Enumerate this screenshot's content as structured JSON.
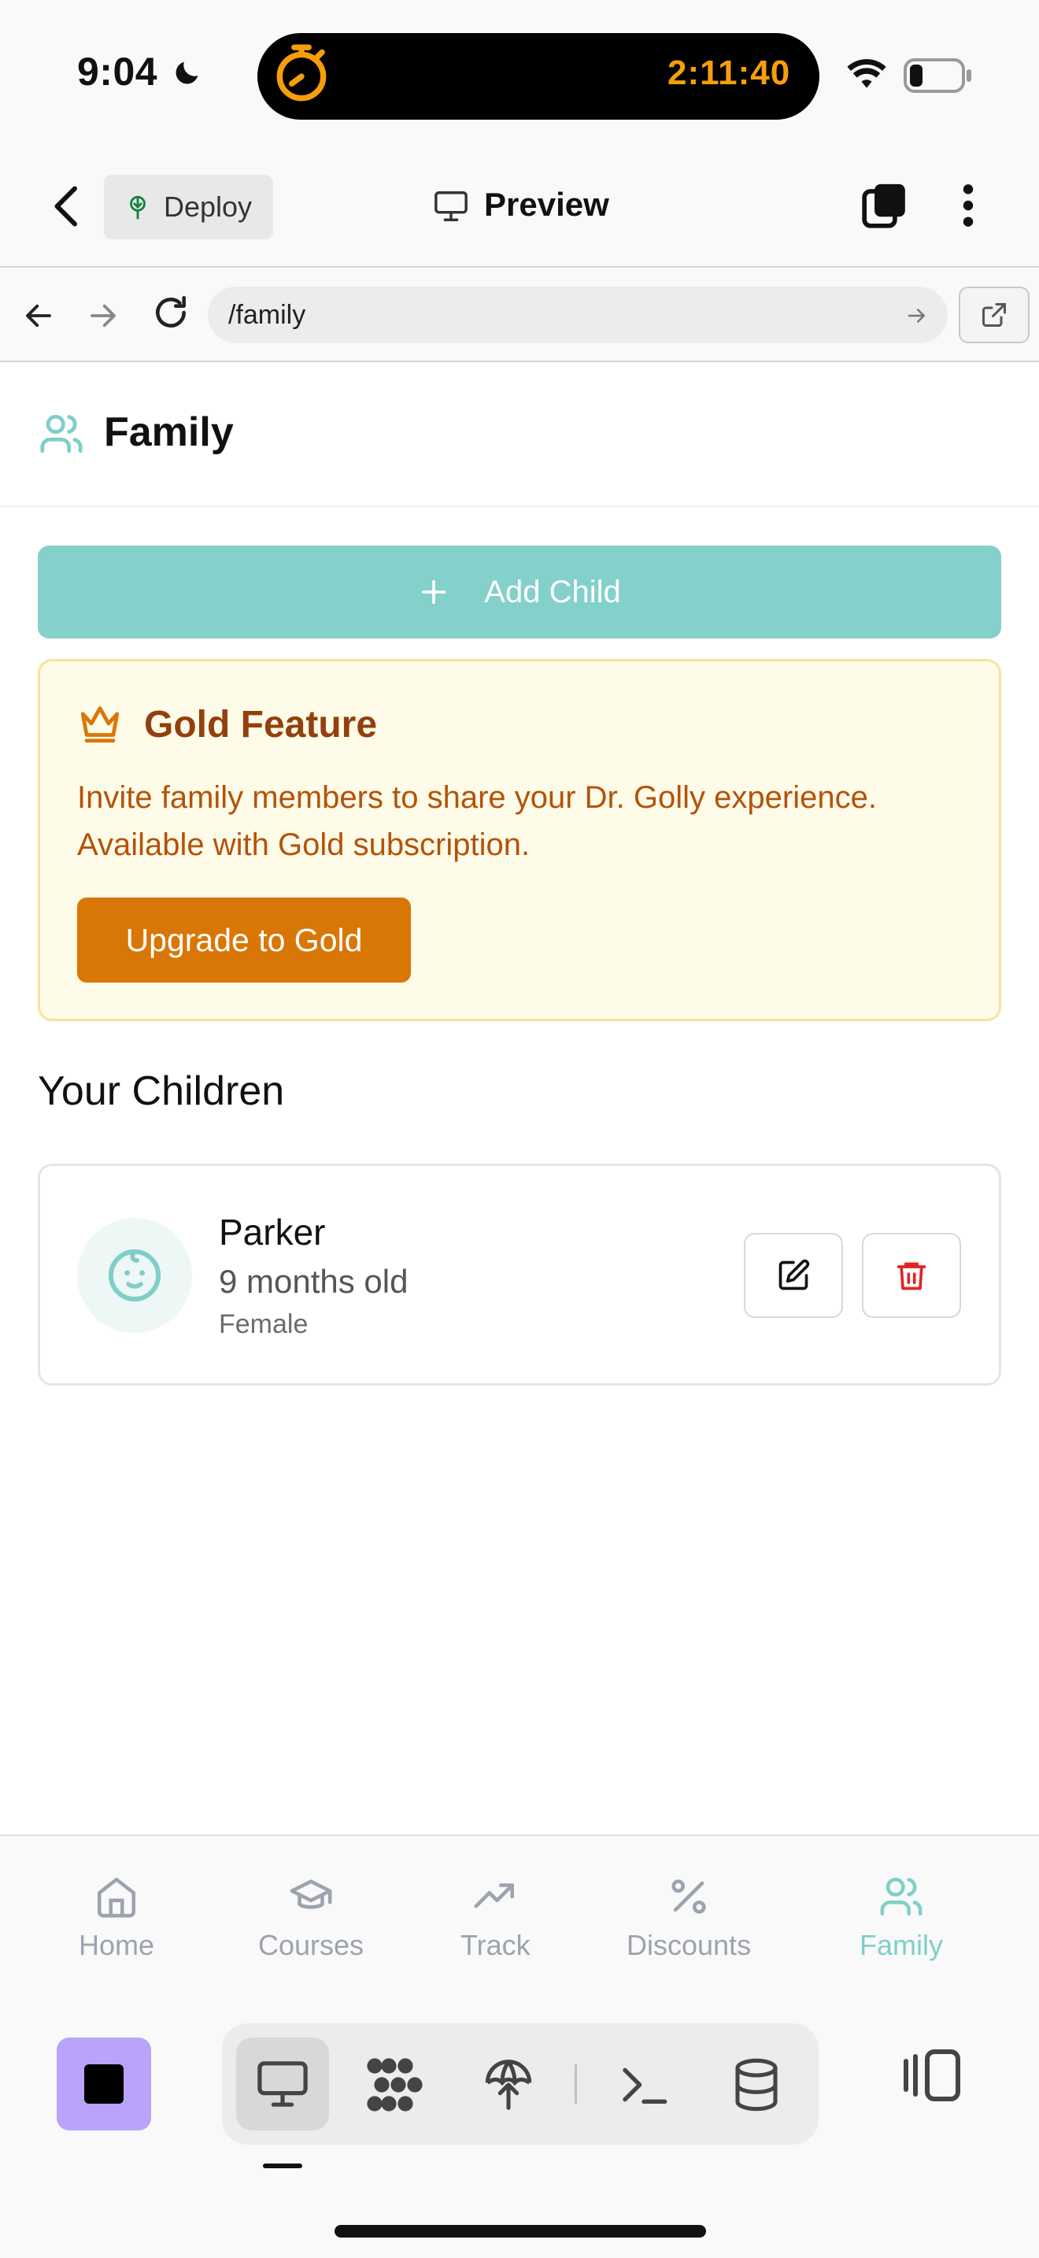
{
  "status_bar": {
    "time": "9:04",
    "timer": "2:11:40"
  },
  "header": {
    "deploy_label": "Deploy",
    "title": "Preview"
  },
  "url_bar": {
    "path": "/family"
  },
  "page": {
    "title": "Family"
  },
  "actions": {
    "add_child_label": "Add Child"
  },
  "gold_card": {
    "title": "Gold Feature",
    "description": "Invite family members to share your Dr. Golly experience. Available with Gold subscription.",
    "button_label": "Upgrade to Gold"
  },
  "children_section": {
    "title": "Your Children"
  },
  "children": [
    {
      "name": "Parker",
      "age": "9 months old",
      "gender": "Female"
    }
  ],
  "bottom_nav": {
    "items": [
      {
        "label": "Home",
        "icon": "home-icon"
      },
      {
        "label": "Courses",
        "icon": "graduation-cap-icon"
      },
      {
        "label": "Track",
        "icon": "trending-up-icon"
      },
      {
        "label": "Discounts",
        "icon": "percent-icon"
      },
      {
        "label": "Family",
        "icon": "users-icon",
        "active": true
      }
    ]
  },
  "colors": {
    "accent": "#84d0ca",
    "gold_bg": "#fefbe8",
    "gold_text": "#b45309",
    "gold_button": "#d97706",
    "delete": "#dc2626",
    "stop_button": "#b9a3fb"
  }
}
